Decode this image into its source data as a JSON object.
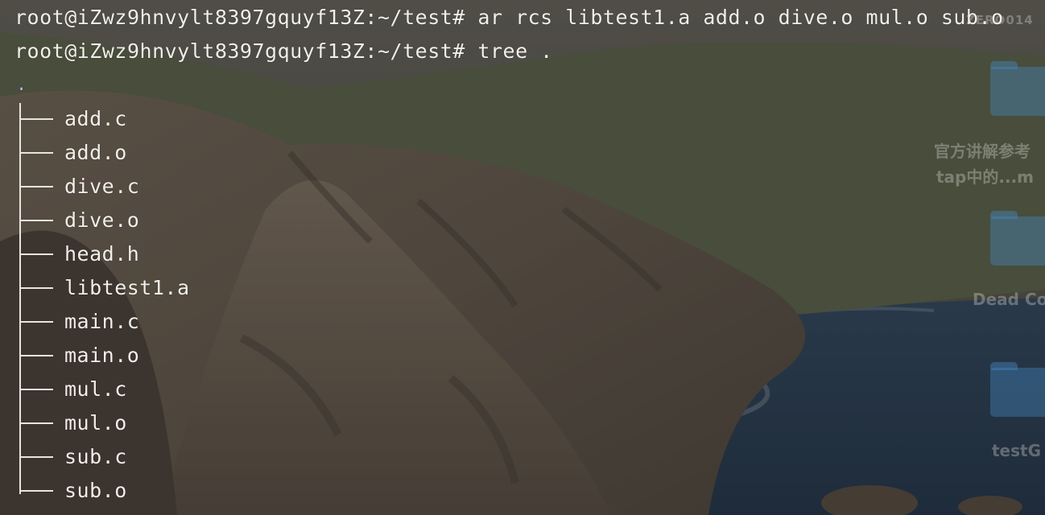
{
  "terminal": {
    "commands": [
      {
        "prompt": "root@iZwz9hnvylt8397gquyf13Z:~/test#",
        "command": "ar rcs libtest1.a add.o dive.o mul.o sub.o"
      },
      {
        "prompt": "root@iZwz9hnvylt8397gquyf13Z:~/test#",
        "command": "tree ."
      }
    ],
    "tree_root": ".",
    "tree_entries": [
      "add.c",
      "add.o",
      "dive.c",
      "dive.o",
      "head.h",
      "libtest1.a",
      "main.c",
      "main.o",
      "mul.c",
      "mul.o",
      "sub.c",
      "sub.o"
    ]
  },
  "desktop": {
    "top_right_label": "ZERO014",
    "items": [
      {
        "label_line1": "官方讲解参考",
        "label_line2": "tap中的...m",
        "icon": "folder-icon"
      },
      {
        "label_line1": "Dead Co",
        "icon": "folder-icon"
      },
      {
        "label_line1": "testG",
        "icon": "folder-icon"
      }
    ]
  },
  "colors": {
    "terminal_text": "#f2efe9",
    "tree_root_dot": "#c9a7e6",
    "folder_blue": "#468cc8",
    "sea": "#1f3b5a"
  }
}
